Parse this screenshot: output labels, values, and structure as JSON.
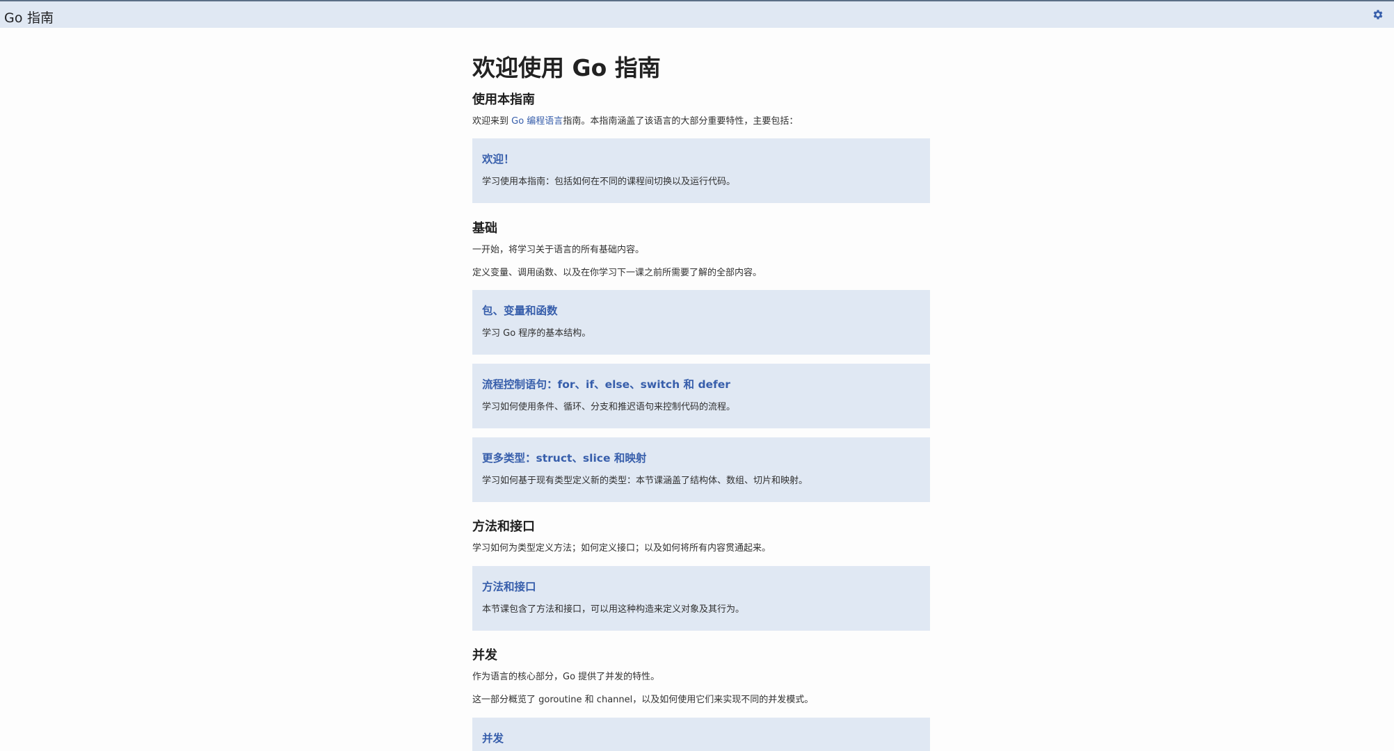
{
  "header": {
    "title": "Go 指南",
    "settings_icon": "gear-icon"
  },
  "page": {
    "title": "欢迎使用 Go 指南"
  },
  "sections": {
    "using": {
      "title": "使用本指南",
      "intro_before": "欢迎来到 ",
      "intro_link": "Go 编程语言",
      "intro_after": "指南。本指南涵盖了该语言的大部分重要特性，主要包括：",
      "cards": [
        {
          "title": "欢迎！",
          "desc": "学习使用本指南：包括如何在不同的课程间切换以及运行代码。"
        }
      ]
    },
    "basics": {
      "title": "基础",
      "paras": [
        "一开始，将学习关于语言的所有基础内容。",
        "定义变量、调用函数、以及在你学习下一课之前所需要了解的全部内容。"
      ],
      "cards": [
        {
          "title": "包、变量和函数",
          "desc": "学习 Go 程序的基本结构。"
        },
        {
          "title": "流程控制语句：for、if、else、switch 和 defer",
          "desc": "学习如何使用条件、循环、分支和推迟语句来控制代码的流程。"
        },
        {
          "title": "更多类型：struct、slice 和映射",
          "desc": "学习如何基于现有类型定义新的类型：本节课涵盖了结构体、数组、切片和映射。"
        }
      ]
    },
    "methods": {
      "title": "方法和接口",
      "paras": [
        "学习如何为类型定义方法；如何定义接口；以及如何将所有内容贯通起来。"
      ],
      "cards": [
        {
          "title": "方法和接口",
          "desc": "本节课包含了方法和接口，可以用这种构造来定义对象及其行为。"
        }
      ]
    },
    "concurrency": {
      "title": "并发",
      "paras": [
        "作为语言的核心部分，Go 提供了并发的特性。",
        "这一部分概览了 goroutine 和 channel，以及如何使用它们来实现不同的并发模式。"
      ],
      "cards": [
        {
          "title": "并发"
        }
      ]
    }
  },
  "colors": {
    "header_bg": "#e0e8f3",
    "card_bg": "#e0e8f3",
    "link": "#375eab"
  }
}
